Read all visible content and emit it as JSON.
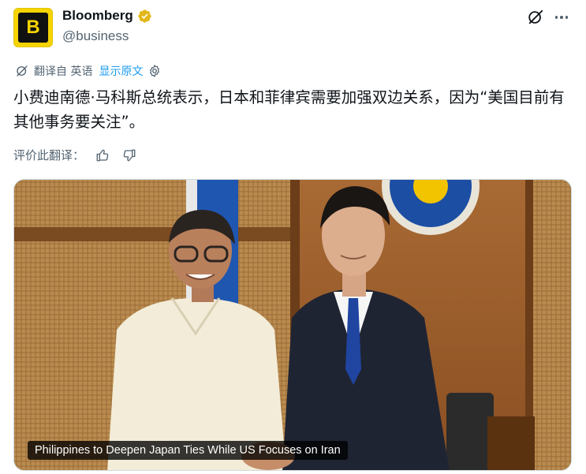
{
  "account": {
    "avatar_letter": "B",
    "display_name": "Bloomberg",
    "handle": "@business",
    "avatar_color": "#f5d400",
    "verified_color": "#e2b719"
  },
  "translation": {
    "source_label": "翻译自 英语",
    "show_original": "显示原文",
    "icon": "translate-icon",
    "settings_icon": "gear-icon"
  },
  "tweet": {
    "text": "小费迪南德·马科斯总统表示，日本和菲律宾需要加强双边关系，因为“美国目前有其他事务要关注”。"
  },
  "rating": {
    "label": "评价此翻译：",
    "like_icon": "thumbs-up-icon",
    "dislike_icon": "thumbs-down-icon"
  },
  "media": {
    "caption": "Philippines to Deepen Japan Ties While US Focuses on Iran"
  },
  "header_actions": {
    "grok_icon": "grok-icon",
    "more_icon": "more-icon"
  },
  "colors": {
    "link": "#1d9bf0",
    "secondary_text": "#536471"
  }
}
